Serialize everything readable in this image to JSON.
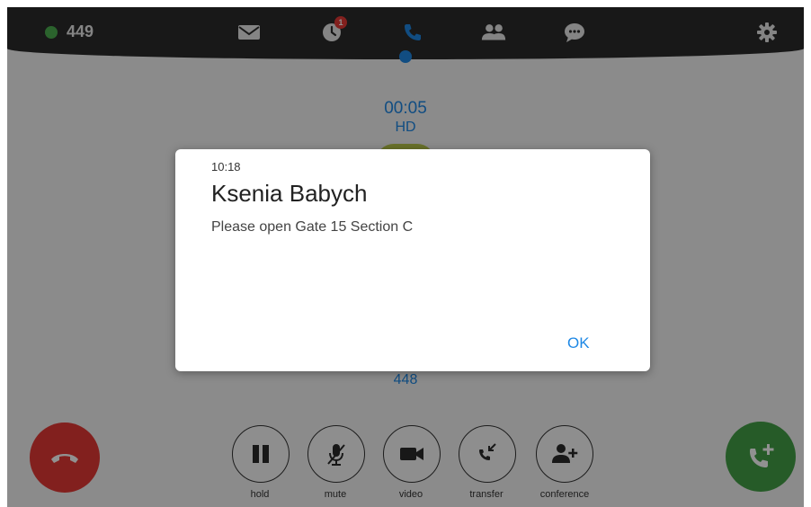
{
  "topbar": {
    "extension": "449",
    "missed_calls_badge": "1",
    "icons": [
      "mail-icon",
      "history-icon",
      "phone-icon",
      "contacts-icon",
      "chat-icon",
      "settings-icon"
    ],
    "active_tab": "phone-icon"
  },
  "call": {
    "timer": "00:05",
    "quality": "HD",
    "remote_extension": "448"
  },
  "controls": {
    "hold": "hold",
    "mute": "mute",
    "video": "video",
    "transfer": "transfer",
    "conference": "conference"
  },
  "dialog": {
    "time": "10:18",
    "title": "Ksenia Babych",
    "message": "Please open Gate 15 Section C",
    "ok_label": "OK"
  },
  "colors": {
    "accent": "#1e88e5",
    "hangup": "#e53935",
    "add_call": "#43a047",
    "status_online": "#4caf50",
    "topbar": "#2b2b2b"
  }
}
